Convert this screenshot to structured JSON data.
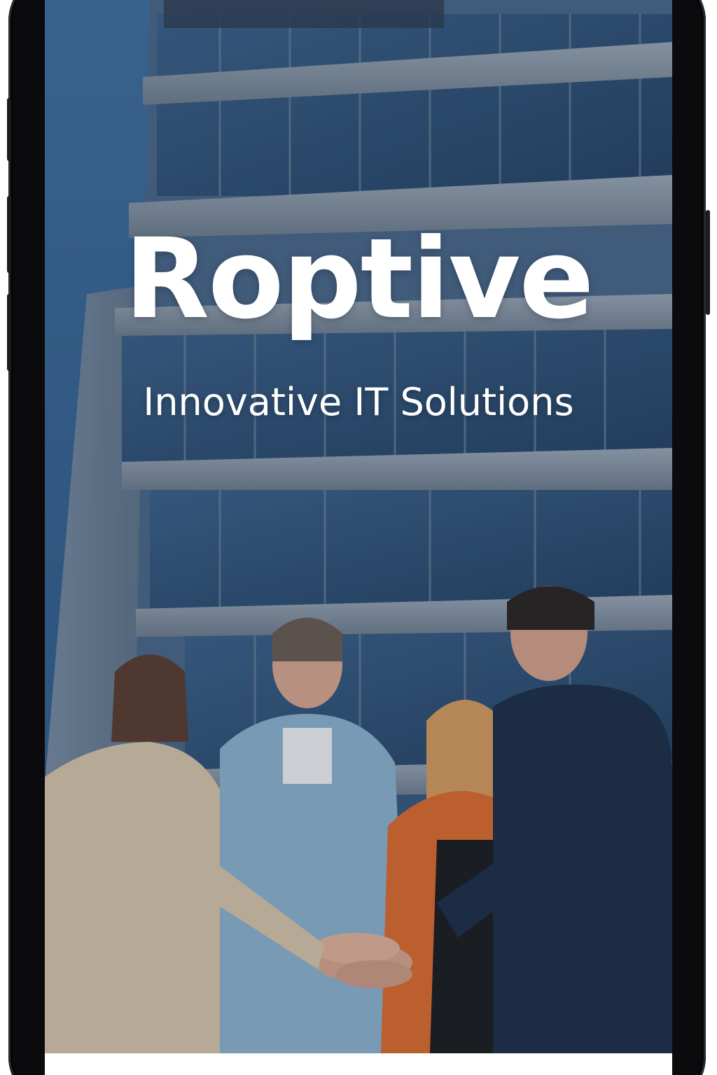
{
  "app": {
    "brand_name": "Roptive",
    "tagline": "Innovative IT Solutions"
  },
  "scene": {
    "background_image": "office-building-photo",
    "foreground_image": "team-hands-stacked-photo"
  },
  "colors": {
    "sky": "#3f6d9c",
    "building": "#7c8a99",
    "glass": "#2d4a6b",
    "text": "#ffffff",
    "frame": "#0b0b0d"
  }
}
